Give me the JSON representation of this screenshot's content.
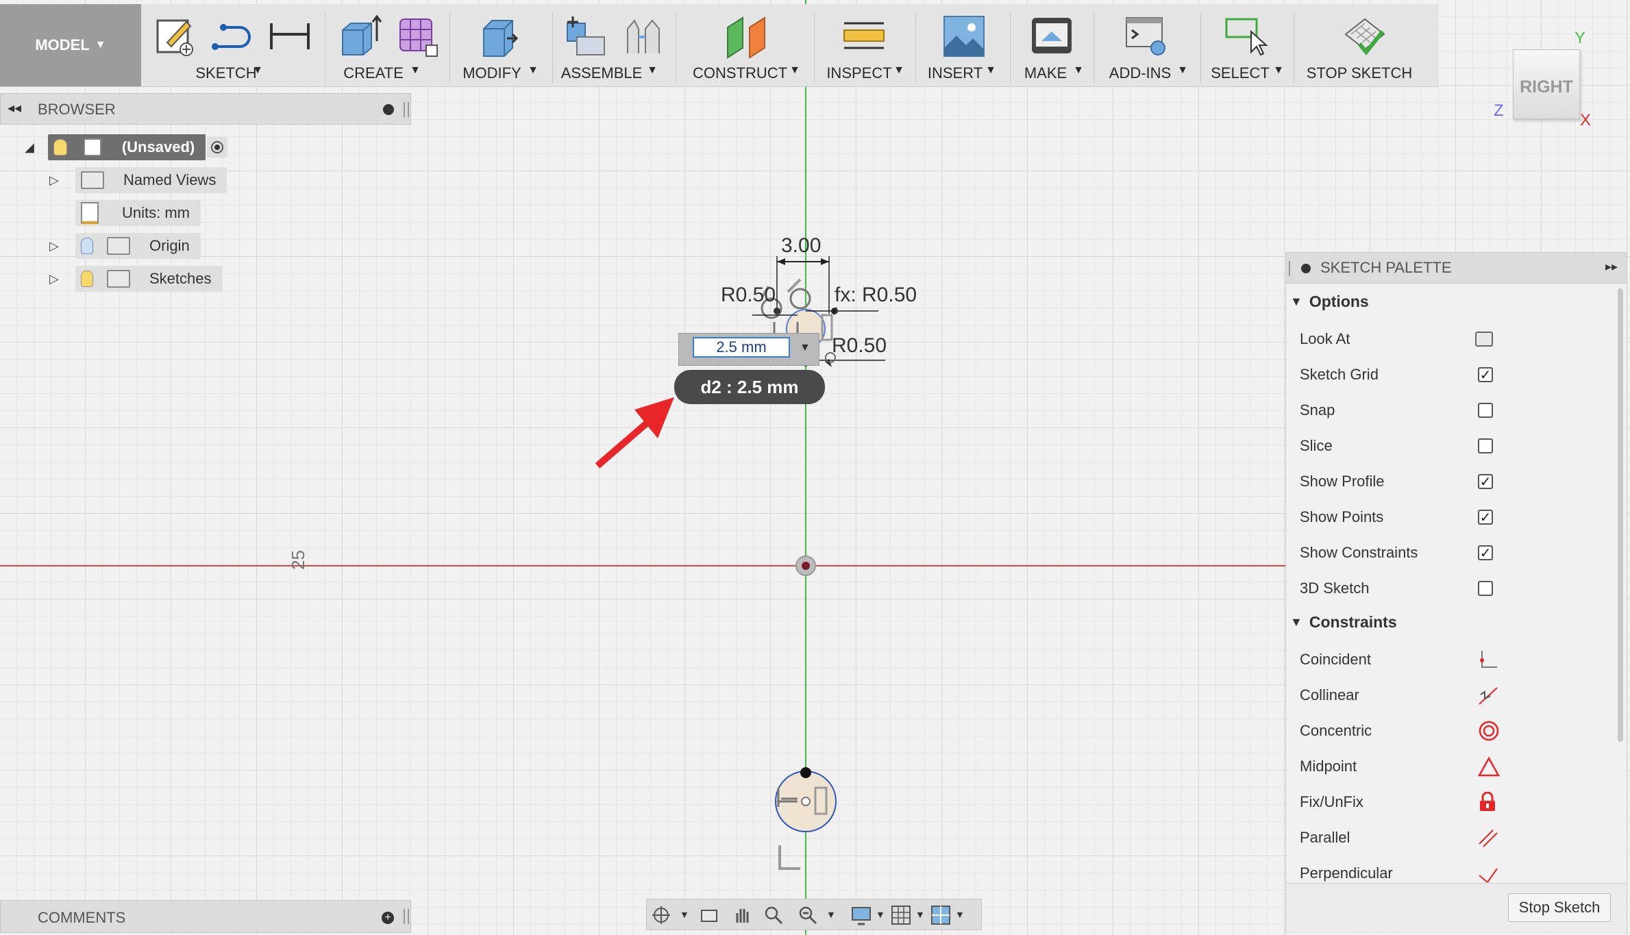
{
  "toolbar": {
    "model_label": "MODEL",
    "groups": [
      {
        "label": "SKETCH"
      },
      {
        "label": "CREATE"
      },
      {
        "label": "MODIFY"
      },
      {
        "label": "ASSEMBLE"
      },
      {
        "label": "CONSTRUCT"
      },
      {
        "label": "INSPECT"
      },
      {
        "label": "INSERT"
      },
      {
        "label": "MAKE"
      },
      {
        "label": "ADD-INS"
      },
      {
        "label": "SELECT"
      },
      {
        "label": "STOP SKETCH"
      }
    ]
  },
  "viewcube": {
    "face": "RIGHT",
    "x_label": "X",
    "y_label": "Y",
    "z_label": "Z"
  },
  "browser": {
    "title": "BROWSER",
    "items": [
      {
        "label": "(Unsaved)"
      },
      {
        "label": "Named Views"
      },
      {
        "label": "Units: mm"
      },
      {
        "label": "Origin"
      },
      {
        "label": "Sketches"
      }
    ]
  },
  "comments": {
    "title": "COMMENTS"
  },
  "canvas": {
    "dim_width": "3.00",
    "dim_r_left": "R0.50",
    "dim_fx": "fx: R0.50",
    "dim_r_right": "R0.50",
    "input_value": "2.5 mm",
    "tooltip": "d2 : 2.5 mm",
    "side_dim": "25"
  },
  "palette": {
    "title": "SKETCH PALETTE",
    "options_title": "Options",
    "options": [
      {
        "label": "Look At",
        "type": "button"
      },
      {
        "label": "Sketch Grid",
        "checked": true
      },
      {
        "label": "Snap",
        "checked": false
      },
      {
        "label": "Slice",
        "checked": false
      },
      {
        "label": "Show Profile",
        "checked": true
      },
      {
        "label": "Show Points",
        "checked": true
      },
      {
        "label": "Show Constraints",
        "checked": true
      },
      {
        "label": "3D Sketch",
        "checked": false
      }
    ],
    "constraints_title": "Constraints",
    "constraints": [
      {
        "label": "Coincident",
        "icon": "coincident-icon"
      },
      {
        "label": "Collinear",
        "icon": "collinear-icon"
      },
      {
        "label": "Concentric",
        "icon": "concentric-icon"
      },
      {
        "label": "Midpoint",
        "icon": "midpoint-icon"
      },
      {
        "label": "Fix/UnFix",
        "icon": "lock-icon"
      },
      {
        "label": "Parallel",
        "icon": "parallel-icon"
      },
      {
        "label": "Perpendicular",
        "icon": "perpendicular-icon"
      }
    ],
    "stop_button": "Stop Sketch"
  },
  "colors": {
    "accent_red": "#e8262a",
    "x_axis": "#d84b4b",
    "y_axis": "#3fc23f"
  }
}
